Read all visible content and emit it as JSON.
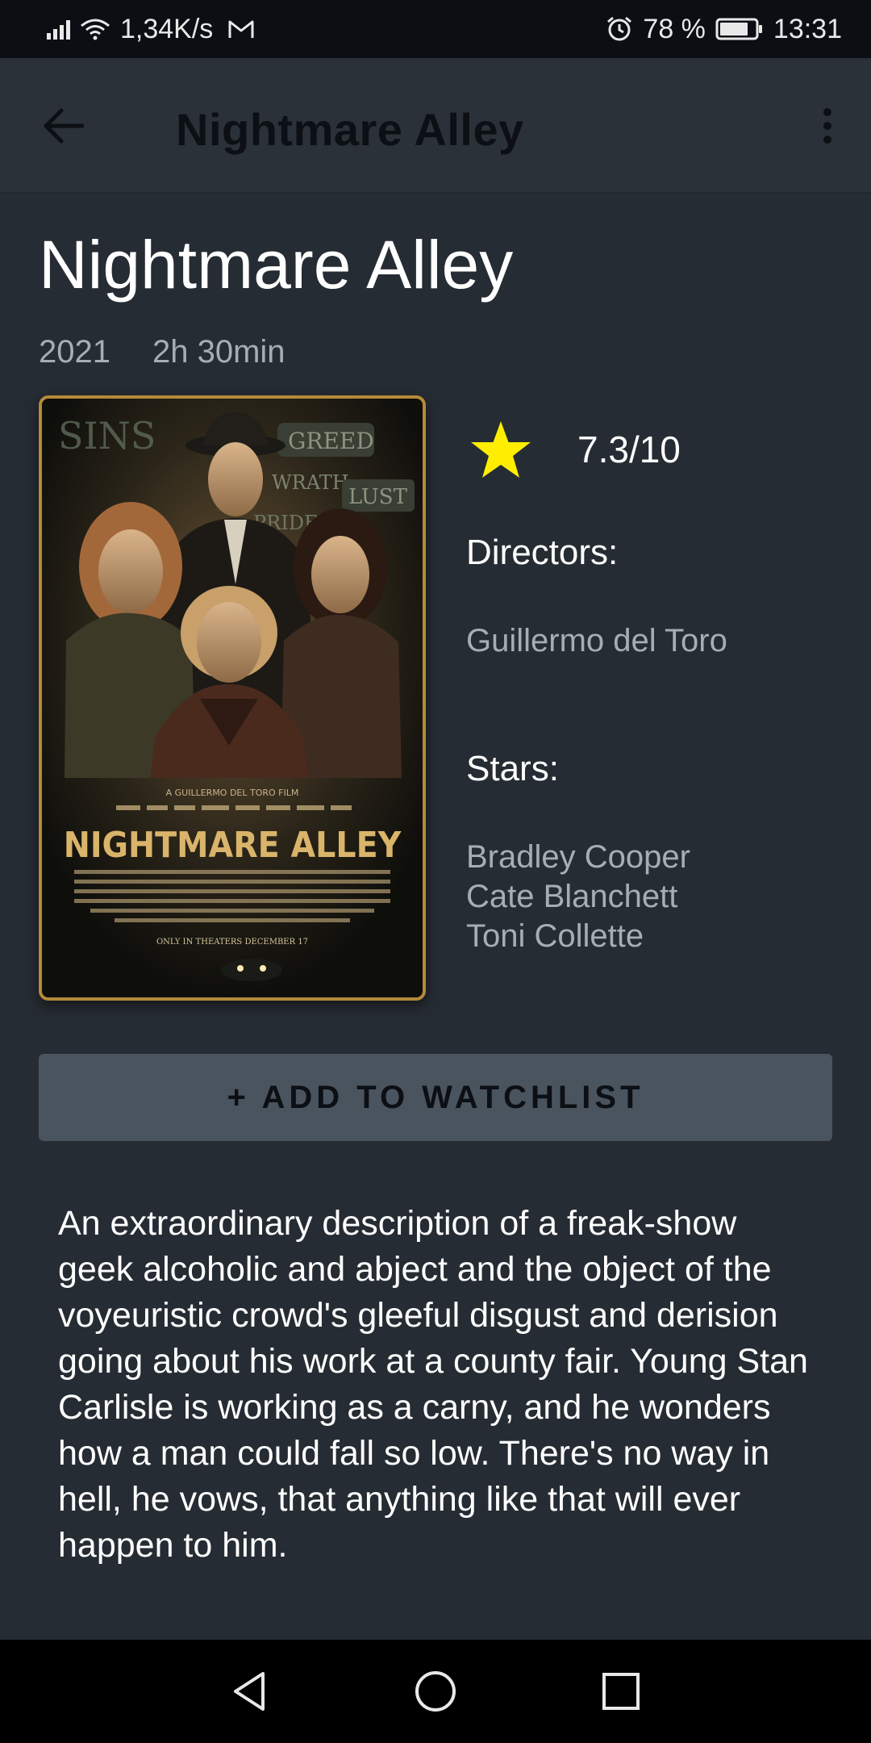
{
  "status_bar": {
    "net_speed": "1,34K/s",
    "battery_percent": "78 %",
    "time": "13:31"
  },
  "app_bar": {
    "title": "Nightmare Alley"
  },
  "movie": {
    "title": "Nightmare Alley",
    "year": "2021",
    "duration": "2h 30min",
    "rating": "7.3/10",
    "directors_label": "Directors:",
    "directors": [
      "Guillermo del Toro"
    ],
    "stars_label": "Stars:",
    "stars": [
      "Bradley Cooper",
      "Cate Blanchett",
      "Toni Collette"
    ],
    "poster": {
      "title": "NIGHTMARE ALLEY",
      "sign_words": [
        "SINS",
        "GREED",
        "WRATH",
        "LUST",
        "PRIDE"
      ],
      "tagline": "ONLY IN THEATERS DECEMBER 17",
      "credit": "A GUILLERMO DEL TORO FILM"
    },
    "description": "An extraordinary description of a freak-show geek alcoholic and abject and the object of the voyeuristic crowd's gleeful disgust and derision going about his work at a county fair. Young Stan Carlisle is working as a carny, and he wonders how a man could fall so low. There's no way in hell, he vows, that anything like that will ever happen to him."
  },
  "actions": {
    "add_to_watchlist": "+ ADD TO WATCHLIST"
  },
  "colors": {
    "background": "#262c33",
    "app_bar": "#2a3139",
    "star": "#ffee00",
    "button": "#4a545f",
    "secondary_text": "#a6adb4"
  }
}
